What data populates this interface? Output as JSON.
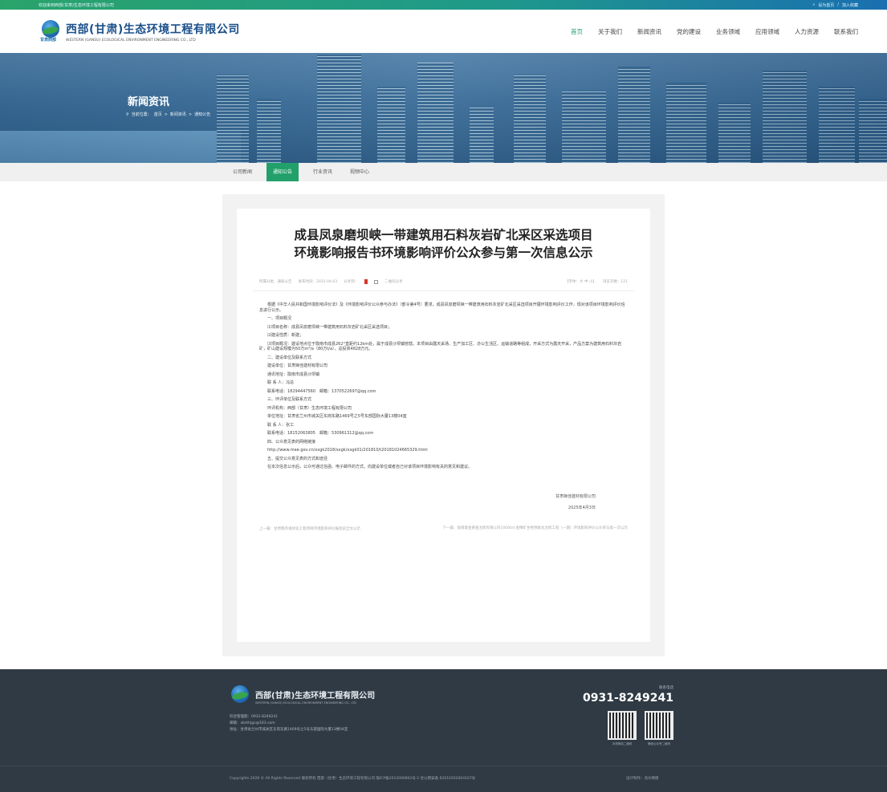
{
  "topbar": {
    "left_text": "欢迎来到西部(甘肃)生态环境工程有限公司",
    "search_icon": "search-icon",
    "right_links": [
      "设为首页",
      "/",
      "加入收藏"
    ]
  },
  "brand": {
    "cn_name": "西部(甘肃)生态环境工程有限公司",
    "en_name": "WESTERN (GANSU) ECOLOGICAL ENVIRONMENT ENGINEERING CO., LTD",
    "badge": "甘肃西部"
  },
  "nav": {
    "items": [
      "首页",
      "关于我们",
      "新闻资讯",
      "党的建设",
      "业务领域",
      "应用领域",
      "人力资源",
      "联系我们"
    ],
    "active_index": 0
  },
  "banner": {
    "title": "新闻资讯",
    "crumb_label": "当前位置：",
    "crumb": [
      "首页",
      ">",
      "新闻资讯",
      ">",
      "通知公告"
    ]
  },
  "subnav": {
    "items": [
      "公司新闻",
      "通知公告",
      "行业资讯",
      "视频中心"
    ],
    "active_index": 1
  },
  "article": {
    "title_line1": "成县凤泉磨坝峡一带建筑用石料灰岩矿北采区采选项目",
    "title_line2": "环境影响报告书环境影响评价公众参与第一次信息公示",
    "meta": {
      "category": "所属分类：通知公告",
      "date": "发布时间：2025-04-03",
      "share": "分享到：",
      "qr": "二维码分享",
      "font": "【字体：大 中 小】",
      "views": "浏览次数：121"
    },
    "paragraphs": [
      "根据《中华人民共和国环境影响评价法》及《环境影响评价公众参与办法》（部令第4号）要求，成县凤泉磨坝峡一带建筑用石料灰岩矿北采区采选项目开展环境影响评价工作，现对该项目环境影响评价信息进行公示。",
      "一、项目概况",
      "⑴项目名称：成县凤泉磨坝峡一带建筑用石料灰岩矿北采区采选项目；",
      "⑵建设性质：新建；",
      "⑶项目概况：建设地点位于陇南市成县262°直距约12km处，属于成县沙坝镇管辖。本项目由露天采场、生产加工区、办公生活区、运输道路等组成，开采方式为露天开采，产品方案为建筑用石料灰岩矿，矿山建设规模为50万m³/a（80万t/a），总投资4828万元。",
      "二、建设单位及联系方式",
      "建设单位：甘肃锋佳建材有限公司",
      "通讯地址：陇南市成县沙坝镇",
      "联 系 人：冯总",
      "联系电话：18294447560　邮箱：1370522697@qq.com",
      "三、环评单位及联系方式",
      "环评机构：西部（甘肃）生态环境工程有限公司",
      "单位地址：甘肃省兰州市城关区东岗东路1469号之5号东部国际大厦13楼04室",
      "联 系 人：张工",
      "联系电话：18152063805　邮箱：530961312@qq.com",
      "四、公众意见表的网络链接",
      "http://www.mee.gov.cn/xxgk2018/xxgk/xxgk01/201810/t20181024665329.html",
      "五、提交公众意见表的方式和途径",
      "在本次信息公示后，公众可通过信函、电子邮件的方式，向建设单位或者自己对该项目环境影响有关的意见和建议。"
    ],
    "signature_company": "甘肃锋佳建材有限公司",
    "signature_date": "2025年4月3日",
    "prev": "上一篇：甘肃两岸滩绿化工程项目环境影响评价报批前全文公示",
    "next": "下一篇：陇南紫金黄金冶炼有限公司1000t/d 金精矿生物预氧化冶炼工程（一期）环境影响评价公众参与第一次公示"
  },
  "footer": {
    "cn_name": "西部(甘肃)生态环境工程有限公司",
    "en_name": "WESTERN (GANSU) ECOLOGICAL ENVIRONMENT ENGINEERING CO., LTD",
    "phone_line": "综合管理部：0931-8249241",
    "email_line": "邮箱：xbsthjgc@163.com",
    "address_line": "地址：甘肃省兰州市城关区东岗东路1469号之5号东部国际大厦13楼04室",
    "hotline_label": "联系电话",
    "hotline": "0931-8249241",
    "qr_captions": [
      "手机网站二维码",
      "微信公众号二维码"
    ],
    "copyright": "Copyrights 2026 © All Rights Reserved 版权所有 西部（甘肃）生态环境工程有限公司 陇ICP备2023000862号-1 甘公网安备 62010202004167号",
    "design": "设计制作：兆众网络"
  },
  "colors": {
    "accent_green": "#22a06b",
    "brand_blue": "#1a4f8a",
    "footer_bg": "#303a44"
  }
}
